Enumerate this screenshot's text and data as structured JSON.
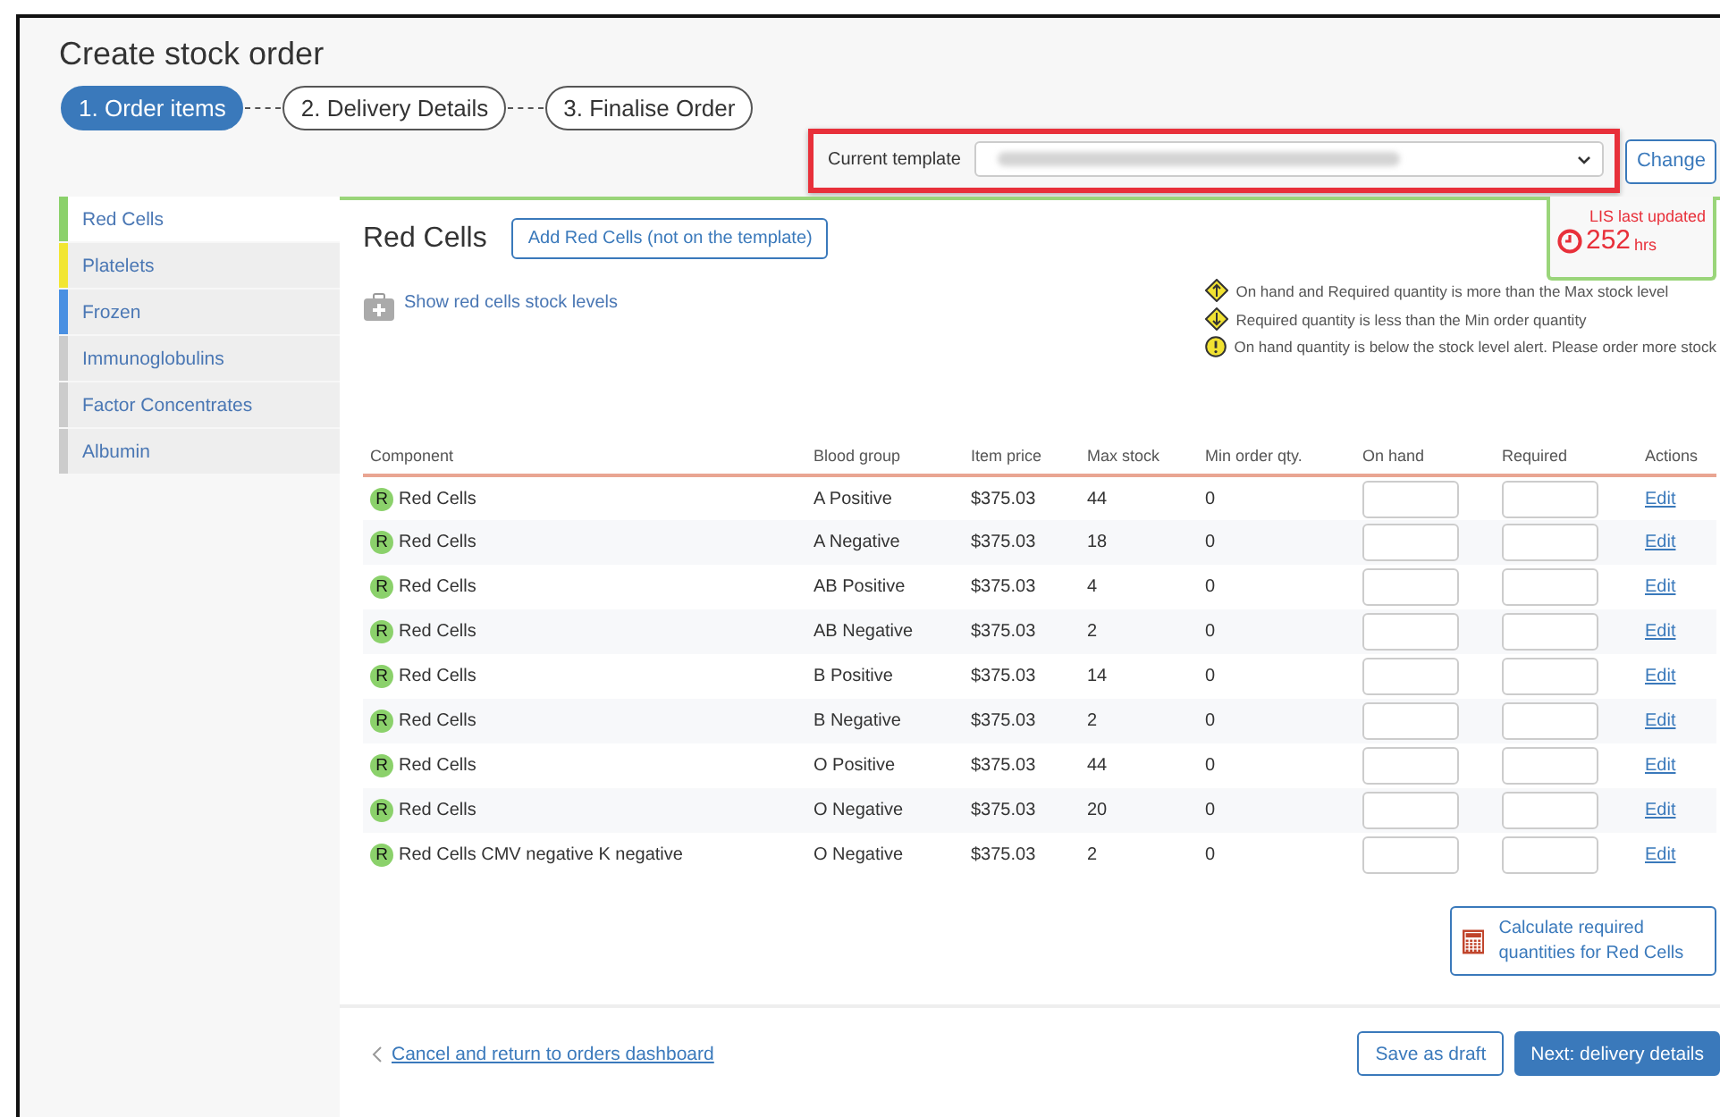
{
  "title": "Create stock order",
  "steps": [
    {
      "label": "1. Order items",
      "selected": true
    },
    {
      "label": "2. Delivery Details",
      "selected": false
    },
    {
      "label": "3. Finalise Order",
      "selected": false
    }
  ],
  "template": {
    "label": "Current template",
    "change": "Change"
  },
  "sidebar": {
    "items": [
      {
        "label": "Red Cells",
        "color": "#8bd16b",
        "selected": true
      },
      {
        "label": "Platelets",
        "color": "#f2e632",
        "selected": false
      },
      {
        "label": "Frozen",
        "color": "#4a90e2",
        "selected": false
      },
      {
        "label": "Immunoglobulins",
        "color": "#cccccc",
        "selected": false
      },
      {
        "label": "Factor Concentrates",
        "color": "#cccccc",
        "selected": false
      },
      {
        "label": "Albumin",
        "color": "#cccccc",
        "selected": false
      }
    ]
  },
  "section": {
    "title": "Red Cells",
    "add_button": "Add Red Cells (not on the template)",
    "stock_link": "Show red cells stock levels"
  },
  "lis": {
    "label": "LIS last updated",
    "value": "252",
    "unit": "hrs"
  },
  "legend": [
    {
      "kind": "up",
      "text": "On hand and Required quantity is more than the Max stock level"
    },
    {
      "kind": "down",
      "text": "Required quantity is less than the Min order quantity"
    },
    {
      "kind": "alert",
      "text": "On hand quantity is below the stock level alert. Please order more stock"
    }
  ],
  "table": {
    "columns": [
      "Component",
      "Blood group",
      "Item price",
      "Max stock",
      "Min order qty.",
      "On hand",
      "Required",
      "Actions"
    ],
    "rows": [
      {
        "badge": "R",
        "component": "Red Cells",
        "group": "A Positive",
        "price": "$375.03",
        "max": "44",
        "min": "0",
        "action": "Edit"
      },
      {
        "badge": "R",
        "component": "Red Cells",
        "group": "A Negative",
        "price": "$375.03",
        "max": "18",
        "min": "0",
        "action": "Edit"
      },
      {
        "badge": "R",
        "component": "Red Cells",
        "group": "AB Positive",
        "price": "$375.03",
        "max": "4",
        "min": "0",
        "action": "Edit"
      },
      {
        "badge": "R",
        "component": "Red Cells",
        "group": "AB Negative",
        "price": "$375.03",
        "max": "2",
        "min": "0",
        "action": "Edit"
      },
      {
        "badge": "R",
        "component": "Red Cells",
        "group": "B Positive",
        "price": "$375.03",
        "max": "14",
        "min": "0",
        "action": "Edit"
      },
      {
        "badge": "R",
        "component": "Red Cells",
        "group": "B Negative",
        "price": "$375.03",
        "max": "2",
        "min": "0",
        "action": "Edit"
      },
      {
        "badge": "R",
        "component": "Red Cells",
        "group": "O Positive",
        "price": "$375.03",
        "max": "44",
        "min": "0",
        "action": "Edit"
      },
      {
        "badge": "R",
        "component": "Red Cells",
        "group": "O Negative",
        "price": "$375.03",
        "max": "20",
        "min": "0",
        "action": "Edit"
      },
      {
        "badge": "R",
        "component": "Red Cells CMV negative K negative",
        "group": "O Negative",
        "price": "$375.03",
        "max": "2",
        "min": "0",
        "action": "Edit"
      }
    ]
  },
  "calculate_button": "Calculate required quantities for Red Cells",
  "footer": {
    "cancel": "Cancel and return to orders dashboard",
    "save": "Save as draft",
    "next": "Next: delivery details"
  }
}
